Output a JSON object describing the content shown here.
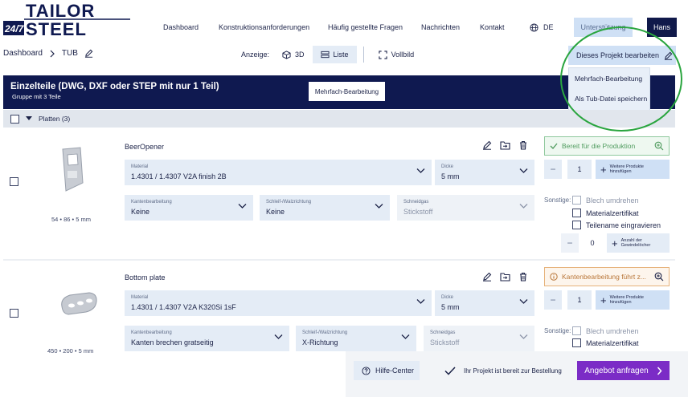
{
  "header": {
    "logo_top": "24/7 TAILOR",
    "logo_main": "TAILOR",
    "logo_bottom": "STEEL",
    "logo_tag": "24/7",
    "nav": [
      "Dashboard",
      "Konstruktionsanforderungen",
      "Häufig gestellte Fragen",
      "Nachrichten",
      "Kontakt"
    ],
    "language": "DE",
    "support_label": "Unterstützung",
    "user": "Hans"
  },
  "breadcrumb": {
    "root": "Dashboard",
    "current": "TUB"
  },
  "view": {
    "label": "Anzeige:",
    "options": [
      "3D",
      "Liste",
      "Vollbild"
    ],
    "active": "Liste"
  },
  "project_menu": {
    "button_label": "Dieses Projekt bearbeiten",
    "items": [
      "Mehrfach-Bearbeitung",
      "Als Tub-Datei speichern"
    ]
  },
  "banner": {
    "title": "Einzelteile (DWG, DXF oder STEP mit nur 1 Teil)",
    "subtitle": "Gruppe mit 3 Teile",
    "multi_edit": "Mehrfach-Bearbeitung"
  },
  "group": {
    "label": "Platten (3)"
  },
  "parts": [
    {
      "name": "BeerOpener",
      "dimensions": "54 • 86 • 5 mm",
      "material_label": "Material",
      "material": "1.4301 / 1.4307 V2A finish 2B",
      "thickness_label": "Dicke",
      "thickness": "5 mm",
      "edge_label": "Kantenbearbeitung",
      "edge": "Keine",
      "grind_label": "Schleif-/Walzrichtung",
      "grind": "Keine",
      "cut_label": "Schneidgas",
      "cut": "Stickstoff",
      "status": "Bereit für die Produktion",
      "status_type": "ok",
      "quantity": "1",
      "add_label_1": "Weitere Produkte",
      "add_label_2": "hinzufügen",
      "other_label": "Sonstige:",
      "options": [
        "Blech umdrehen",
        "Materialzertifikat",
        "Teilename eingravieren"
      ],
      "threads": "0",
      "threads_label_1": "Anzahl der",
      "threads_label_2": "Gewindelöcher"
    },
    {
      "name": "Bottom plate",
      "dimensions": "450 • 200 • 5 mm",
      "material_label": "Material",
      "material": "1.4301 / 1.4307 V2A K320Si 1sF",
      "thickness_label": "Dicke",
      "thickness": "5 mm",
      "edge_label": "Kantenbearbeitung",
      "edge": "Kanten brechen gratseitig",
      "grind_label": "Schleif-/Walzrichtung",
      "grind": "X-Richtung",
      "cut_label": "Schneidgas",
      "cut": "Stickstoff",
      "status": "Kantenbearbeitung führt z...",
      "status_type": "warn",
      "quantity": "1",
      "add_label_1": "Weitere Produkte",
      "add_label_2": "hinzufügen",
      "other_label": "Sonstige:",
      "options": [
        "Blech umdrehen",
        "Materialzertifikat"
      ]
    }
  ],
  "footer": {
    "help": "Hilfe-Center",
    "ready": "Ihr Projekt ist bereit zur Bestellung",
    "cta": "Angebot anfragen"
  },
  "colors": {
    "navy": "#0f1950",
    "light_blue": "#cfe0f5",
    "field_bg": "#e4ecf6",
    "cta_purple": "#7b2cc6",
    "highlight_circle": "#2aa53f"
  }
}
